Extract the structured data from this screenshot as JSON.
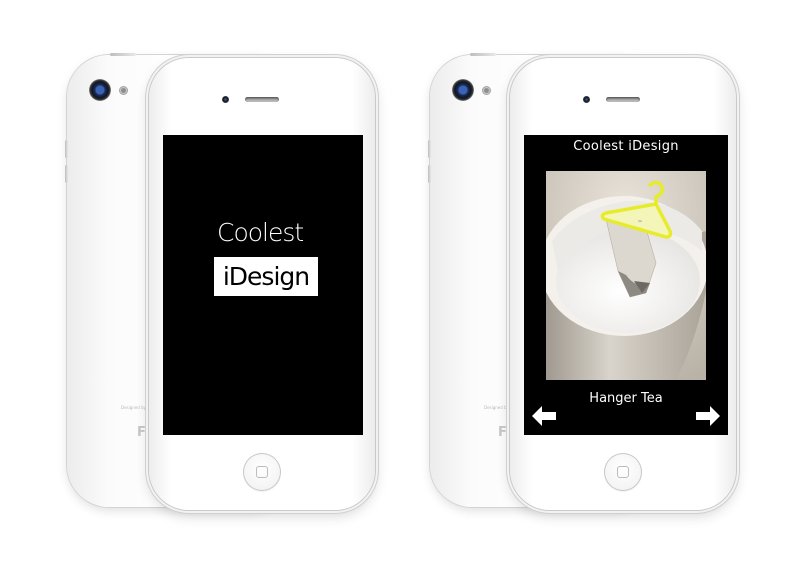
{
  "splash": {
    "title_line1": "Coolest",
    "title_line2": "iDesign"
  },
  "gallery": {
    "header_title": "Coolest iDesign",
    "item_caption": "Hanger Tea",
    "prev_icon": "arrow-left-icon",
    "next_icon": "arrow-right-icon"
  },
  "device": {
    "back_model_text": "Designed by ... Model A1387",
    "back_logo": "FC"
  },
  "colors": {
    "screen_bg": "#000000",
    "accent_hanger": "#e6ec2c",
    "text": "#ffffff"
  }
}
